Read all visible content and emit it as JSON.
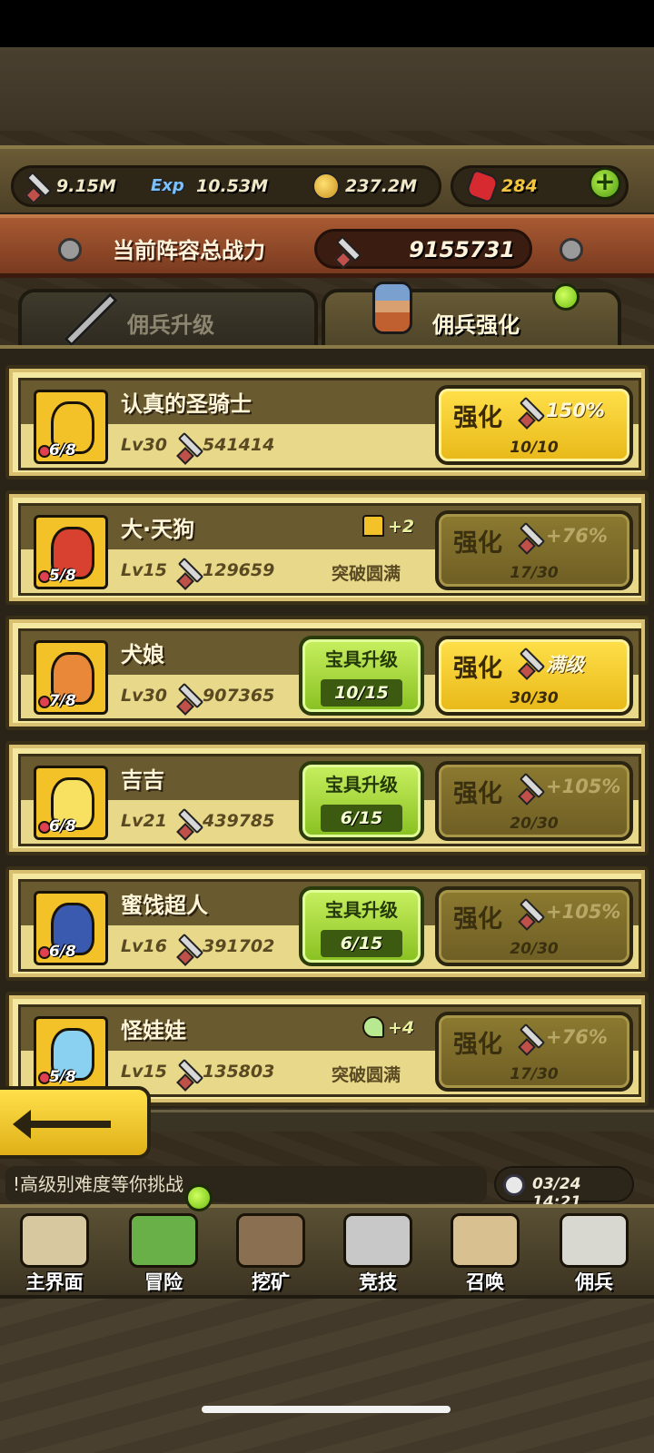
{
  "resources": {
    "power": "9.15M",
    "exp_label": "Exp",
    "exp": "10.53M",
    "coins": "237.2M",
    "gems": "284",
    "add_label": "+"
  },
  "formation": {
    "label": "当前阵容总战力",
    "value": "9155731"
  },
  "tabs": [
    {
      "label": "佣兵升级",
      "active": false
    },
    {
      "label": "佣兵强化",
      "active": true
    }
  ],
  "mercenaries": [
    {
      "name": "认真的圣骑士",
      "level": "Lv30",
      "power": "541414",
      "stars": "6/8",
      "enhance_label": "强化",
      "enhance_pct": "150%",
      "enhance_level": "10/10",
      "enhance_active": true,
      "portrait_color": "#f2c228",
      "face_color": "#f0b070"
    },
    {
      "name": "大·天狗",
      "level": "Lv15",
      "power": "129659",
      "stars": "5/8",
      "break_bonus": "+2",
      "break_status": "突破圆满",
      "enhance_label": "强化",
      "enhance_pct": "+76%",
      "enhance_level": "17/30",
      "enhance_active": false,
      "portrait_color": "#f2c228",
      "face_color": "#d84030"
    },
    {
      "name": "犬娘",
      "level": "Lv30",
      "power": "907365",
      "stars": "7/8",
      "treasure_label": "宝具升级",
      "treasure_level": "10/15",
      "enhance_label": "强化",
      "enhance_pct": "满级",
      "enhance_level": "30/30",
      "enhance_active": true,
      "portrait_color": "#f2c228",
      "face_color": "#e88838"
    },
    {
      "name": "吉吉",
      "level": "Lv21",
      "power": "439785",
      "stars": "6/8",
      "treasure_label": "宝具升级",
      "treasure_level": "6/15",
      "enhance_label": "强化",
      "enhance_pct": "+105%",
      "enhance_level": "20/30",
      "enhance_active": false,
      "portrait_color": "#f2c228",
      "face_color": "#f8e060"
    },
    {
      "name": "蜜饯超人",
      "level": "Lv16",
      "power": "391702",
      "stars": "6/8",
      "treasure_label": "宝具升级",
      "treasure_level": "6/15",
      "enhance_label": "强化",
      "enhance_pct": "+105%",
      "enhance_level": "20/30",
      "enhance_active": false,
      "portrait_color": "#f2c228",
      "face_color": "#3a5ab0"
    },
    {
      "name": "怪娃娃",
      "level": "Lv15",
      "power": "135803",
      "stars": "5/8",
      "break_bonus": "+4",
      "break_status": "突破圆满",
      "enhance_label": "强化",
      "enhance_pct": "+76%",
      "enhance_level": "17/30",
      "enhance_active": false,
      "portrait_color": "#f2c228",
      "face_color": "#8ad0f0"
    }
  ],
  "ticker": "!高级别难度等你挑战",
  "clock": "03/24 14:21",
  "nav": [
    {
      "label": "主界面",
      "icon": "map-scroll-icon",
      "color": "#d8c8a0"
    },
    {
      "label": "冒险",
      "icon": "floating-island-icon",
      "color": "#6ab048"
    },
    {
      "label": "挖矿",
      "icon": "pickaxe-icon",
      "color": "#8a7050"
    },
    {
      "label": "竞技",
      "icon": "crossed-swords-icon",
      "color": "#c8c8c8"
    },
    {
      "label": "召唤",
      "icon": "summon-scroll-icon",
      "color": "#d8c090"
    },
    {
      "label": "佣兵",
      "icon": "tent-icon",
      "color": "#d8d8d0"
    }
  ],
  "colors": {
    "enhance_active": "#ffe04a",
    "enhance_inactive": "#8c7a30",
    "treasure_green": "#a8d83c",
    "notify_green": "#8ed428"
  }
}
